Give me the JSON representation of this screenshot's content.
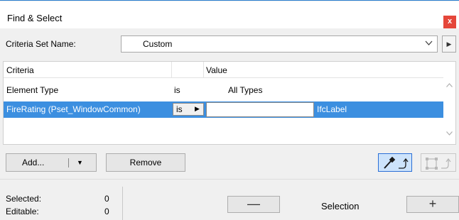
{
  "window": {
    "title": "Find & Select",
    "close_label": "x"
  },
  "criteria_set": {
    "label": "Criteria Set Name:",
    "value": "Custom"
  },
  "table": {
    "headers": {
      "criteria": "Criteria",
      "value": "Value"
    },
    "rows": [
      {
        "criteria": "Element Type",
        "operator": "is",
        "value": "All Types"
      },
      {
        "criteria": "FireRating (Pset_WindowCommon)",
        "operator": "is",
        "value": "",
        "type": "IfcLabel"
      }
    ]
  },
  "buttons": {
    "add": "Add...",
    "remove": "Remove"
  },
  "status": {
    "selected_label": "Selected:",
    "selected_value": "0",
    "editable_label": "Editable:",
    "editable_value": "0"
  },
  "selection": {
    "label": "Selection",
    "minus": "—",
    "plus": "+"
  },
  "colors": {
    "selection_highlight": "#3c8fe0",
    "close_button": "#e5463a",
    "accent_border": "#2a6fd6"
  },
  "icons": [
    "close-icon",
    "chevron-down-icon",
    "triangle-right-icon",
    "scroll-up-icon",
    "scroll-down-icon",
    "eyedropper-icon",
    "marquee-select-icon"
  ]
}
